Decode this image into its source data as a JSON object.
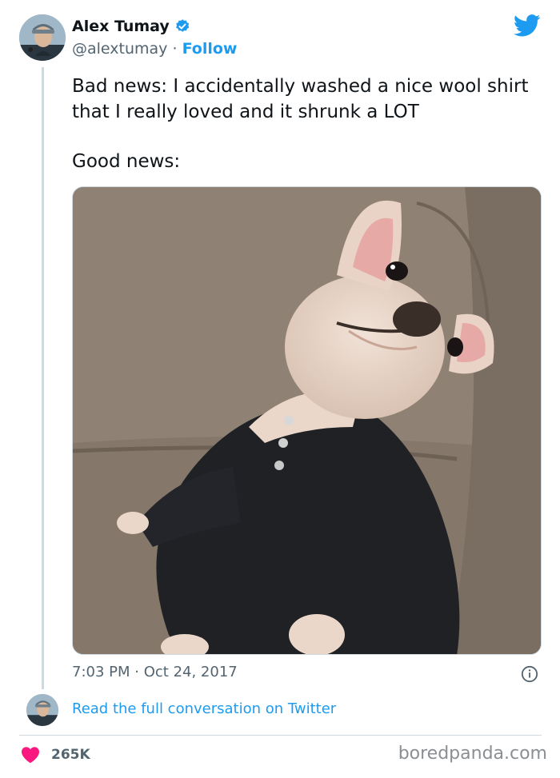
{
  "author": {
    "name": "Alex Tumay",
    "handle": "@alextumay",
    "separator": "·",
    "follow_label": "Follow"
  },
  "tweet": {
    "line1": "Bad news: I accidentally washed a nice wool shirt that I really loved and it shrunk a LOT",
    "line2": "Good news:",
    "time": "7:03 PM",
    "date": "Oct 24, 2017",
    "dot": "·"
  },
  "footer": {
    "read_link": "Read the full conversation on Twitter",
    "likes": "265K"
  },
  "watermark": "boredpanda.com",
  "colors": {
    "accent": "#1d9bf0",
    "like": "#f91880",
    "muted": "#536471"
  },
  "icons": [
    "verified-badge-icon",
    "twitter-bird-icon",
    "info-icon",
    "heart-icon"
  ]
}
